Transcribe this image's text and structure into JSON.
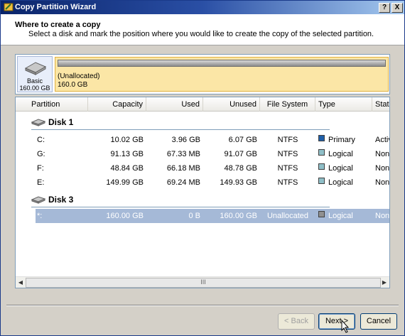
{
  "window": {
    "title": "Copy Partition Wizard",
    "help_label": "?",
    "close_label": "X"
  },
  "header": {
    "title": "Where to create a copy",
    "description": "Select a disk and mark the position where you would like to create the copy of the selected partition."
  },
  "disk_map": {
    "disk_type": "Basic",
    "disk_size": "160.00 GB",
    "partition_name": "(Unallocated)",
    "partition_size": "160.0 GB"
  },
  "table": {
    "columns": [
      "Partition",
      "Capacity",
      "Used",
      "Unused",
      "File System",
      "Type",
      "Status"
    ],
    "disks": [
      {
        "name": "Disk 1",
        "partitions": [
          {
            "partition": "C:",
            "capacity": "10.02 GB",
            "used": "3.96 GB",
            "unused": "6.07 GB",
            "fs": "NTFS",
            "type": "Primary",
            "type_color": "#1f5fa8",
            "status": "Active"
          },
          {
            "partition": "G:",
            "capacity": "91.13 GB",
            "used": "67.33 MB",
            "unused": "91.07 GB",
            "fs": "NTFS",
            "type": "Logical",
            "type_color": "#8fbfc8",
            "status": "None"
          },
          {
            "partition": "F:",
            "capacity": "48.84 GB",
            "used": "66.18 MB",
            "unused": "48.78 GB",
            "fs": "NTFS",
            "type": "Logical",
            "type_color": "#8fbfc8",
            "status": "None"
          },
          {
            "partition": "E:",
            "capacity": "149.99 GB",
            "used": "69.24 MB",
            "unused": "149.93 GB",
            "fs": "NTFS",
            "type": "Logical",
            "type_color": "#8fbfc8",
            "status": "None"
          }
        ]
      },
      {
        "name": "Disk 3",
        "partitions": [
          {
            "partition": "*:",
            "capacity": "160.00 GB",
            "used": "0 B",
            "unused": "160.00 GB",
            "fs": "Unallocated",
            "type": "Logical",
            "type_color": "#909090",
            "status": "None",
            "selected": true
          }
        ]
      }
    ],
    "scroll_thumb_label": "III"
  },
  "buttons": {
    "back": "< Back",
    "next": "Next >",
    "cancel": "Cancel"
  }
}
